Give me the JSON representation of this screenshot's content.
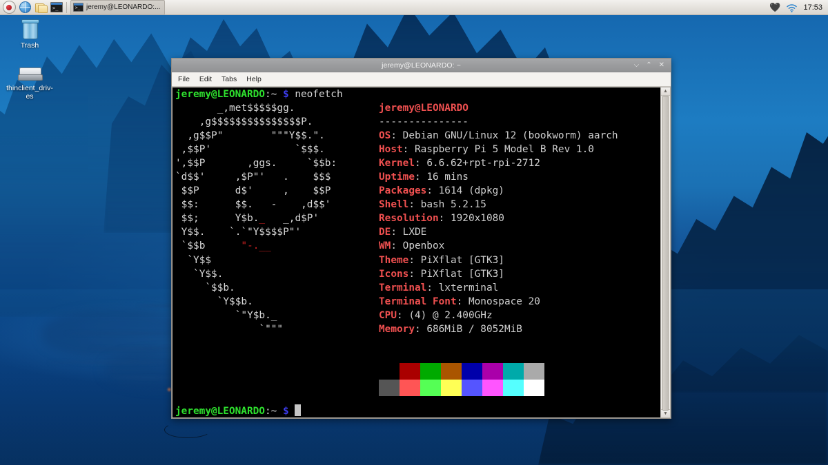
{
  "taskbar": {
    "launchers": [
      {
        "name": "raspberry-menu-icon",
        "label": "Raspberry Pi Menu"
      },
      {
        "name": "web-browser-icon",
        "label": "Web Browser"
      },
      {
        "name": "file-manager-icon",
        "label": "File Manager"
      },
      {
        "name": "terminal-launcher-icon",
        "label": "Terminal"
      }
    ],
    "task_window": "jeremy@LEONARDO:...",
    "bluetooth_icon": "bluetooth-icon",
    "wifi_icon": "wifi-icon",
    "clock": "17:53"
  },
  "desktop": {
    "icons": [
      {
        "name": "trash",
        "label": "Trash"
      },
      {
        "name": "thinclient-drives",
        "label": "thinclient_driv-\nes"
      }
    ]
  },
  "window": {
    "title": "jeremy@LEONARDO: ~",
    "menu": [
      "File",
      "Edit",
      "Tabs",
      "Help"
    ],
    "buttons": {
      "minimize": "⌵",
      "maximize": "⌃",
      "close": "✕"
    }
  },
  "terminal": {
    "prompt": {
      "user_host": "jeremy@LEONARDO",
      "path": ":~",
      "sigil": "$"
    },
    "command": "neofetch",
    "ascii_art": [
      "       _,met$$$$$gg.",
      "    ,g$$$$$$$$$$$$$$$P.",
      "  ,g$$P\"        \"\"\"Y$$.\".",
      " ,$$P'              `$$$.",
      "',$$P       ,ggs.     `$$b:",
      "`d$$'     ,$P\"'   .    $$$",
      " $$P      d$'     ,    $$P",
      " $$:      $$.   -    ,d$$'",
      " $$;      Y$b._   _,d$P'",
      " Y$$.    `.`\"Y$$$$P\"'",
      " `$$b      \"-.__",
      "  `Y$$",
      "   `Y$$.",
      "     `$$b.",
      "       `Y$$b.",
      "          `\"Y$b._",
      "              `\"\"\""
    ],
    "info_header": "jeremy@LEONARDO",
    "info_rule": "---------------",
    "info": [
      {
        "key": "OS",
        "value": "Debian GNU/Linux 12 (bookworm) aarch"
      },
      {
        "key": "Host",
        "value": "Raspberry Pi 5 Model B Rev 1.0"
      },
      {
        "key": "Kernel",
        "value": "6.6.62+rpt-rpi-2712"
      },
      {
        "key": "Uptime",
        "value": "16 mins"
      },
      {
        "key": "Packages",
        "value": "1614 (dpkg)"
      },
      {
        "key": "Shell",
        "value": "bash 5.2.15"
      },
      {
        "key": "Resolution",
        "value": "1920x1080"
      },
      {
        "key": "DE",
        "value": "LXDE"
      },
      {
        "key": "WM",
        "value": "Openbox"
      },
      {
        "key": "Theme",
        "value": "PiXflat [GTK3]"
      },
      {
        "key": "Icons",
        "value": "PiXflat [GTK3]"
      },
      {
        "key": "Terminal",
        "value": "lxterminal"
      },
      {
        "key": "Terminal Font",
        "value": "Monospace 20"
      },
      {
        "key": "CPU",
        "value": "(4) @ 2.400GHz"
      },
      {
        "key": "Memory",
        "value": "686MiB / 8052MiB"
      }
    ],
    "palette": {
      "row_normal": [
        "#000000",
        "#aa0000",
        "#00aa00",
        "#aa5500",
        "#0000aa",
        "#aa00aa",
        "#00aaaa",
        "#aaaaaa"
      ],
      "row_bright": [
        "#555555",
        "#ff5555",
        "#55ff55",
        "#ffff55",
        "#5555ff",
        "#ff55ff",
        "#55ffff",
        "#ffffff"
      ]
    },
    "colors": {
      "background": "#000000",
      "prompt_user": "#2ee02e",
      "prompt_sigil": "#3d3df0",
      "label": "#f05050",
      "value": "#cfcfcf"
    }
  }
}
